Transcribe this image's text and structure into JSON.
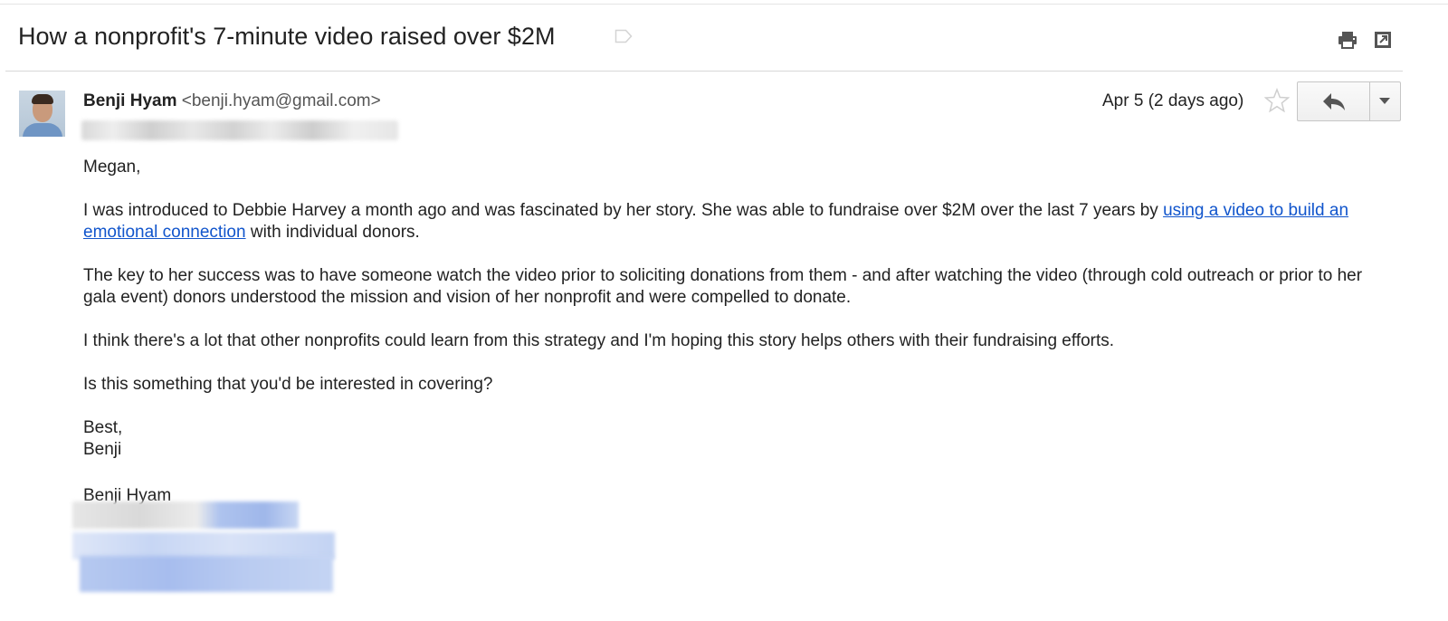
{
  "email": {
    "subject": "How a nonprofit's 7-minute video raised over $2M",
    "sender_name": "Benji Hyam",
    "sender_email": "<benji.hyam@gmail.com>",
    "date": "Apr 5 (2 days ago)",
    "body": {
      "greeting": "Megan,",
      "p1_text": "I was introduced to Debbie Harvey a month ago and was fascinated by her story. She was able to fundraise over $2M over the last 7 years by ",
      "p1_link": "using a video to build an emotional connection",
      "p1_end": " with individual donors.",
      "p2": "The key to her success was to have someone watch the video prior to soliciting donations from them - and after watching the video (through cold outreach or prior to her gala event) donors understood the mission and vision of her nonprofit and were compelled to donate.",
      "p3": "I think there's a lot that other nonprofits could learn from this strategy and I'm hoping this story helps others with their fundraising efforts.",
      "p4": "Is this something that you'd be interested in covering?",
      "closing": "Best,",
      "closing_name": "Benji"
    },
    "signature_name": "Benji Hyam"
  },
  "icons": {
    "label": "label-icon",
    "print": "print-icon",
    "popout": "new-window-icon",
    "star": "star-icon",
    "reply": "reply-icon",
    "more": "dropdown-arrow-icon"
  },
  "colors": {
    "link": "#1155cc",
    "text": "#222222",
    "rule": "#d8d8d8"
  }
}
